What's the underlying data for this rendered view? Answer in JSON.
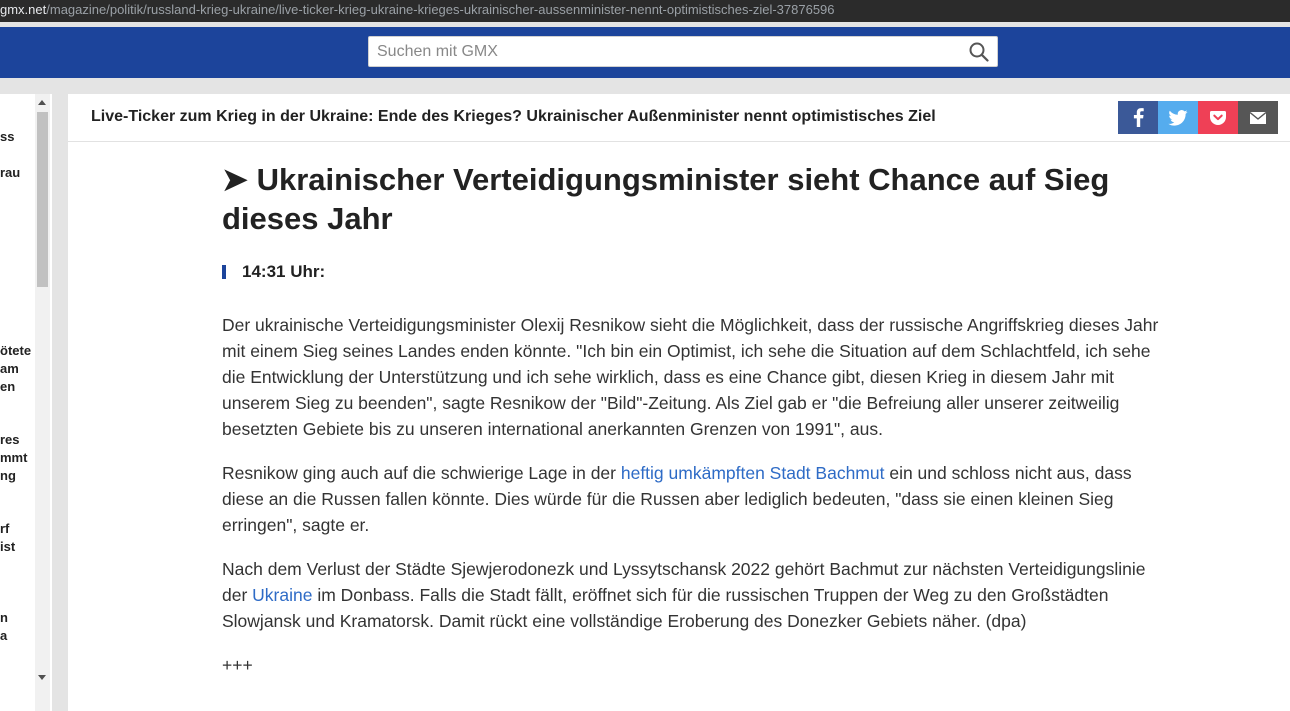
{
  "browser": {
    "url_domain": "gmx.net",
    "url_path": "/magazine/politik/russland-krieg-ukraine/live-ticker-krieg-ukraine-krieges-ukrainischer-aussenminister-nennt-optimistisches-ziel-37876596"
  },
  "search": {
    "placeholder": "Suchen mit GMX"
  },
  "sidebar": {
    "fragments": [
      "ss",
      "rau",
      "ötete",
      "am",
      "en",
      "res",
      "mmt",
      "ng",
      "rf",
      "ist",
      "n",
      "a"
    ]
  },
  "ticker_bar": {
    "title": "Live-Ticker zum Krieg in der Ukraine: Ende des Krieges? Ukrainischer Außenminister nennt optimistisches Ziel"
  },
  "share": {
    "facebook": "facebook-icon",
    "twitter": "twitter-icon",
    "pocket": "pocket-icon",
    "mail": "mail-icon",
    "colors": {
      "facebook": "#3b5998",
      "twitter": "#55acee",
      "pocket": "#ef4056",
      "mail": "#565656"
    }
  },
  "article": {
    "headline": "➤ Ukrainischer Verteidigungsminister sieht Chance auf Sieg dieses Jahr",
    "time": "14:31 Uhr:",
    "p1": "Der ukrainische Verteidigungsminister Olexij Resnikow sieht die Möglichkeit, dass der russische Angriffskrieg dieses Jahr mit einem Sieg seines Landes enden könnte. \"Ich bin ein Optimist, ich sehe die Situation auf dem Schlachtfeld, ich sehe die Entwicklung der Unterstützung und ich sehe wirklich, dass es eine Chance gibt, diesen Krieg in diesem Jahr mit unserem Sieg zu beenden\", sagte Resnikow der \"Bild\"-Zeitung. Als Ziel gab er \"die Befreiung aller unserer zeitweilig besetzten Gebiete bis zu unseren international anerkannten Grenzen von 1991\", aus.",
    "p2_before": "Resnikow ging auch auf die schwierige Lage in der ",
    "p2_link": "heftig umkämpften Stadt Bachmut",
    "p2_after": " ein und schloss nicht aus, dass diese an die Russen fallen könnte. Dies würde für die Russen aber lediglich bedeuten, \"dass sie einen kleinen Sieg erringen\", sagte er.",
    "p3_before": "Nach dem Verlust der Städte Sjewjerodonezk und Lyssytschansk 2022 gehört Bachmut zur nächsten Verteidigungslinie der ",
    "p3_link": "Ukraine",
    "p3_after": " im Donbass. Falls die Stadt fällt, eröffnet sich für die russischen Truppen der Weg zu den Großstädten Slowjansk und Kramatorsk. Damit rückt eine vollständige Eroberung des Donezker Gebiets näher. (dpa)",
    "separator": "+++"
  },
  "colors": {
    "header_blue": "#1c449b",
    "link": "#2e6bc6"
  }
}
